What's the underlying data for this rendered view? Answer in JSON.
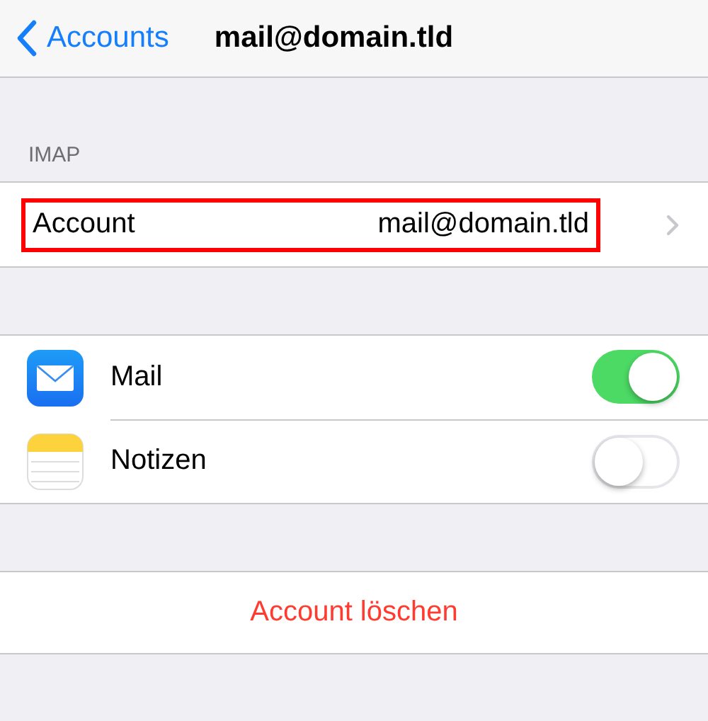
{
  "nav": {
    "back_label": "Accounts",
    "title": "mail@domain.tld"
  },
  "section_header": "IMAP",
  "account_row": {
    "label": "Account",
    "value": "mail@domain.tld",
    "highlighted": true
  },
  "apps": [
    {
      "name": "Mail",
      "kind": "mail",
      "on": true
    },
    {
      "name": "Notizen",
      "kind": "notes",
      "on": false
    }
  ],
  "delete_button": "Account löschen"
}
